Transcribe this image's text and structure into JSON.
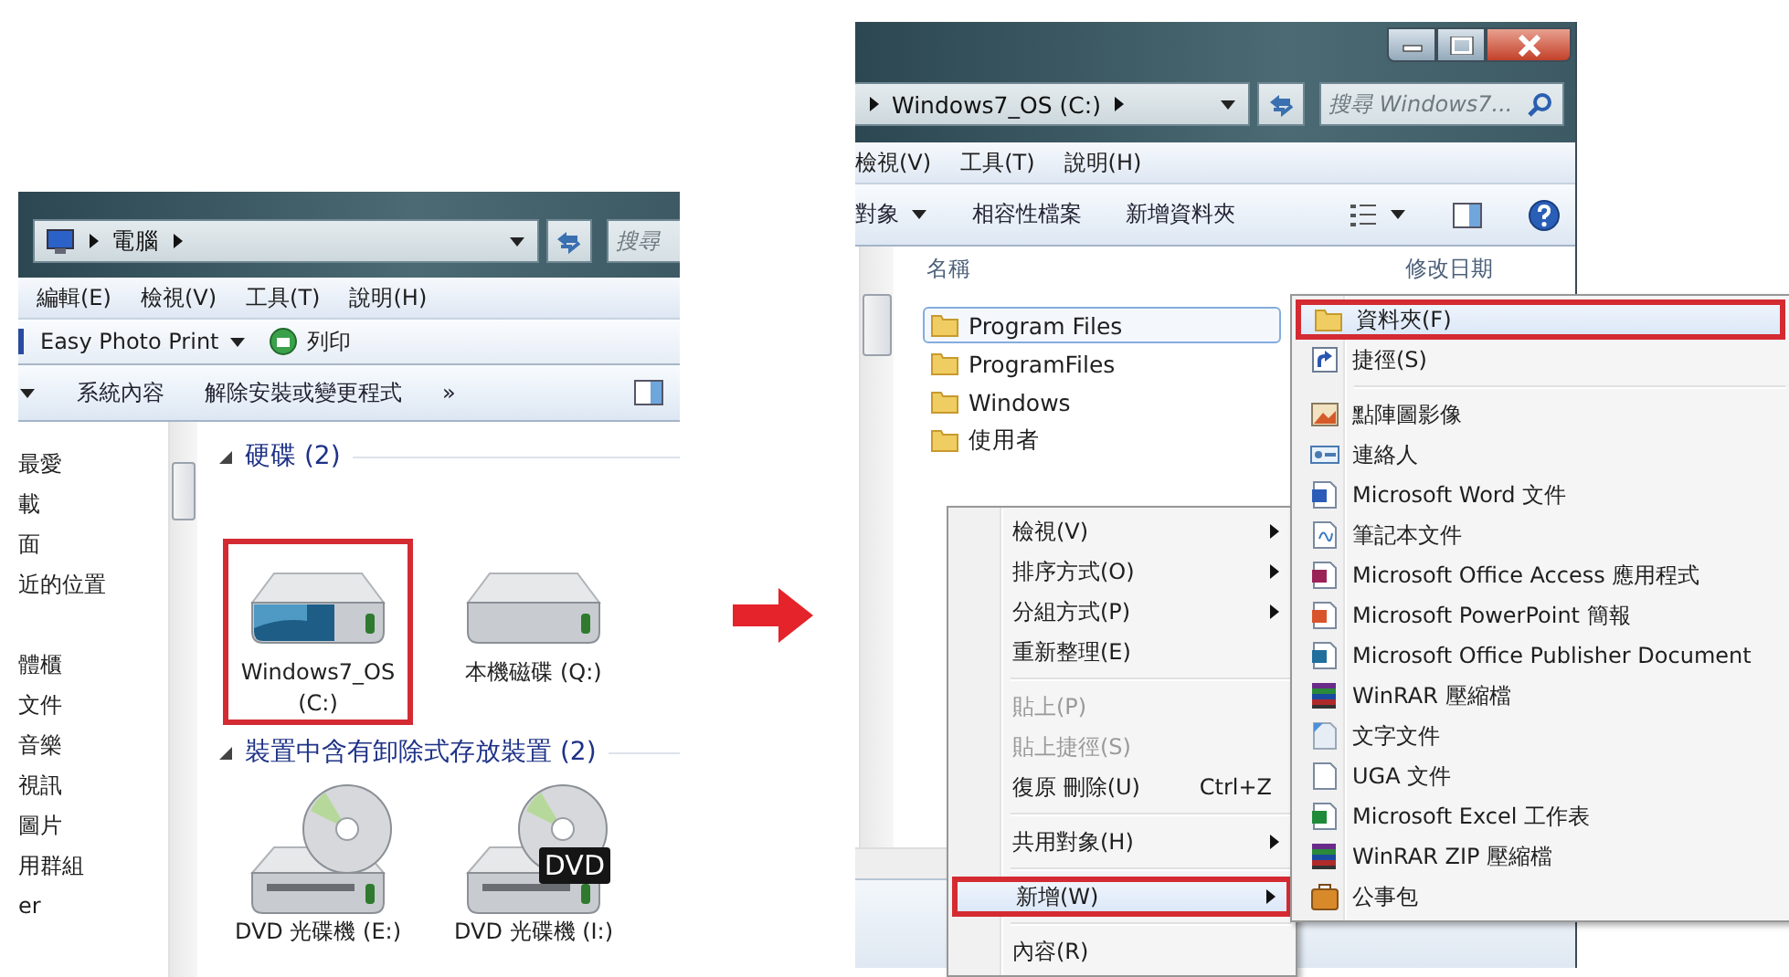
{
  "left_window": {
    "address": {
      "path": [
        "電腦"
      ],
      "search_placeholder": "搜尋"
    },
    "menu": [
      "編輯(E)",
      "檢視(V)",
      "工具(T)",
      "說明(H)"
    ],
    "toolbar": [
      {
        "kind": "dropdown",
        "label": "Easy Photo Print"
      },
      {
        "kind": "print",
        "label": "列印"
      }
    ],
    "commands": [
      {
        "kind": "caret"
      },
      {
        "kind": "text",
        "label": "系統內容"
      },
      {
        "kind": "text",
        "label": "解除安裝或變更程式"
      },
      {
        "kind": "text",
        "label": "»"
      },
      {
        "kind": "preview"
      }
    ],
    "nav_groups": [
      {
        "items": [
          "最愛",
          "載",
          "面",
          "近的位置"
        ]
      },
      {
        "items": [
          "體櫃",
          "文件",
          "音樂",
          "視訊",
          "圖片",
          "用群組",
          "er"
        ]
      }
    ],
    "groups": [
      {
        "title": "硬碟 (2)",
        "drives": [
          {
            "kind": "hdd-system",
            "label": "Windows7_OS (C:)",
            "highlighted": true
          },
          {
            "kind": "hdd",
            "label": "本機磁碟 (Q:)",
            "highlighted": false
          }
        ]
      },
      {
        "title": "裝置中含有卸除式存放裝置 (2)",
        "drives": [
          {
            "kind": "dvd",
            "label": "DVD 光碟機 (E:)",
            "highlighted": false
          },
          {
            "kind": "dvd",
            "label": "DVD 光碟機 (I:)",
            "badge": "DVD",
            "highlighted": false
          }
        ]
      }
    ]
  },
  "right_window": {
    "address": {
      "path": [
        "Windows7_OS (C:)"
      ],
      "search_placeholder": "搜尋 Windows7..."
    },
    "menu": [
      "檢視(V)",
      "工具(T)",
      "說明(H)"
    ],
    "commands": [
      {
        "kind": "dropdown",
        "label": "對象"
      },
      {
        "kind": "text",
        "label": "相容性檔案"
      },
      {
        "kind": "text",
        "label": "新增資料夾"
      },
      {
        "kind": "views"
      },
      {
        "kind": "preview"
      },
      {
        "kind": "help"
      }
    ],
    "columns": [
      "名稱",
      "修改日期"
    ],
    "files": [
      {
        "name": "Program Files",
        "selected": true
      },
      {
        "name": "ProgramFiles",
        "selected": false
      },
      {
        "name": "Windows",
        "selected": false
      },
      {
        "name": "使用者",
        "selected": false
      }
    ]
  },
  "context_menu": {
    "items": [
      {
        "kind": "item",
        "label": "檢視(V)",
        "submenu": true,
        "disabled": false,
        "highlighted": false
      },
      {
        "kind": "item",
        "label": "排序方式(O)",
        "submenu": true,
        "disabled": false,
        "highlighted": false
      },
      {
        "kind": "item",
        "label": "分組方式(P)",
        "submenu": true,
        "disabled": false,
        "highlighted": false
      },
      {
        "kind": "item",
        "label": "重新整理(E)",
        "submenu": false,
        "disabled": false,
        "highlighted": false
      },
      {
        "kind": "separator"
      },
      {
        "kind": "item",
        "label": "貼上(P)",
        "submenu": false,
        "disabled": true,
        "highlighted": false
      },
      {
        "kind": "item",
        "label": "貼上捷徑(S)",
        "submenu": false,
        "disabled": true,
        "highlighted": false
      },
      {
        "kind": "item",
        "label": "復原 刪除(U)",
        "shortcut": "Ctrl+Z",
        "submenu": false,
        "disabled": false,
        "highlighted": false
      },
      {
        "kind": "separator"
      },
      {
        "kind": "item",
        "label": "共用對象(H)",
        "submenu": true,
        "disabled": false,
        "highlighted": false
      },
      {
        "kind": "separator"
      },
      {
        "kind": "item",
        "label": "新增(W)",
        "submenu": true,
        "disabled": false,
        "highlighted": true
      },
      {
        "kind": "separator"
      },
      {
        "kind": "item",
        "label": "內容(R)",
        "submenu": false,
        "disabled": false,
        "highlighted": false
      }
    ]
  },
  "new_menu": {
    "items": [
      {
        "kind": "folder",
        "label": "資料夾(F)",
        "highlighted": true
      },
      {
        "kind": "shortcut",
        "label": "捷徑(S)",
        "highlighted": false
      },
      {
        "kind": "separator"
      },
      {
        "kind": "bitmap",
        "label": "點陣圖影像",
        "highlighted": false
      },
      {
        "kind": "contact",
        "label": "連絡人",
        "highlighted": false
      },
      {
        "kind": "word",
        "label": "Microsoft Word 文件",
        "highlighted": false
      },
      {
        "kind": "notepad",
        "label": "筆記本文件",
        "highlighted": false
      },
      {
        "kind": "access",
        "label": "Microsoft Office Access 應用程式",
        "highlighted": false
      },
      {
        "kind": "powerpoint",
        "label": "Microsoft PowerPoint 簡報",
        "highlighted": false
      },
      {
        "kind": "publisher",
        "label": "Microsoft Office Publisher Document",
        "highlighted": false
      },
      {
        "kind": "winrar",
        "label": "WinRAR 壓縮檔",
        "highlighted": false
      },
      {
        "kind": "text",
        "label": "文字文件",
        "highlighted": false
      },
      {
        "kind": "blank",
        "label": "UGA 文件",
        "highlighted": false
      },
      {
        "kind": "excel",
        "label": "Microsoft Excel 工作表",
        "highlighted": false
      },
      {
        "kind": "winrar",
        "label": "WinRAR ZIP 壓縮檔",
        "highlighted": false
      },
      {
        "kind": "briefcase",
        "label": "公事包",
        "highlighted": false
      }
    ]
  }
}
